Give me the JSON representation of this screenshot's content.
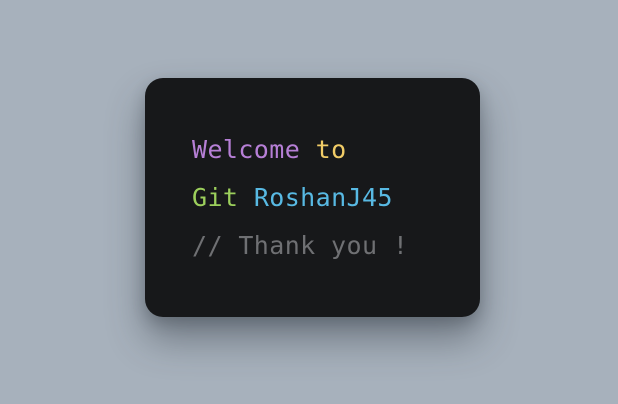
{
  "colors": {
    "background": "#a7b1bc",
    "card": "#17181a",
    "purple": "#b67fd6",
    "yellow": "#f1cc67",
    "green": "#9ccf5c",
    "blue": "#58b9e3",
    "comment": "#6f7073"
  },
  "card": {
    "line1": {
      "word1": "Welcome",
      "space": " ",
      "word2": "to"
    },
    "line2": {
      "word1": "Git",
      "space": " ",
      "word2": "RoshanJ45"
    },
    "line3": {
      "comment": "// Thank you !"
    }
  }
}
